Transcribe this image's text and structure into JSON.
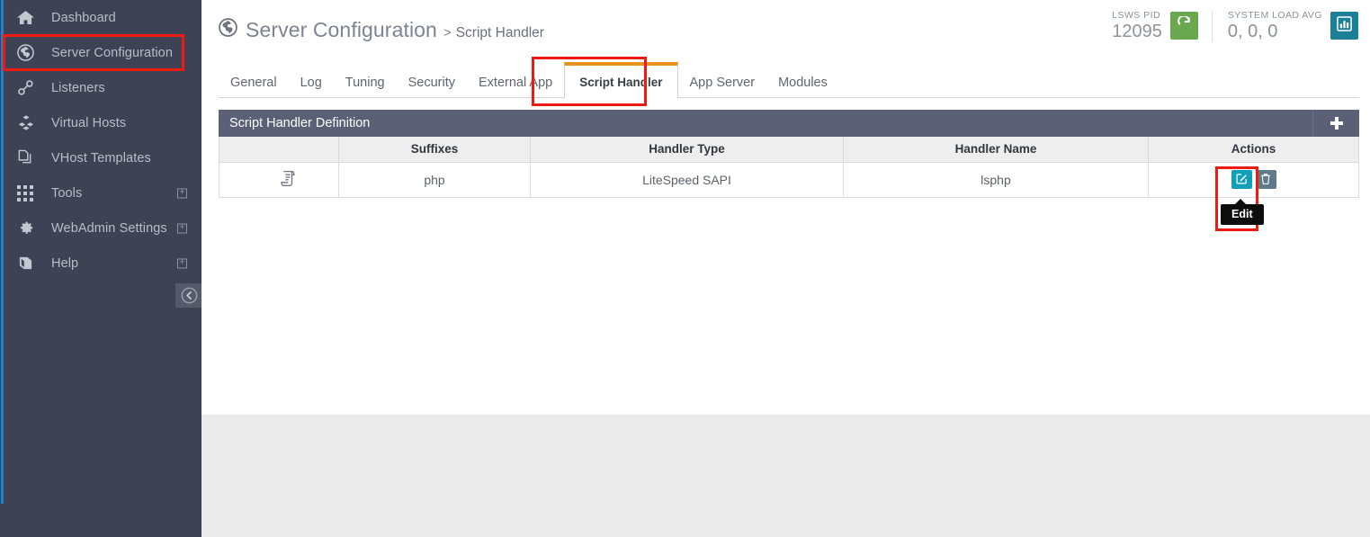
{
  "sidebar": {
    "items": [
      {
        "label": "Dashboard",
        "icon": "home-icon",
        "expandable": false,
        "highlighted": false
      },
      {
        "label": "Server Configuration",
        "icon": "globe-icon",
        "expandable": false,
        "highlighted": true
      },
      {
        "label": "Listeners",
        "icon": "link-icon",
        "expandable": false,
        "highlighted": false
      },
      {
        "label": "Virtual Hosts",
        "icon": "cubes-icon",
        "expandable": false,
        "highlighted": false
      },
      {
        "label": "VHost Templates",
        "icon": "copy-icon",
        "expandable": false,
        "highlighted": false
      },
      {
        "label": "Tools",
        "icon": "grid-icon",
        "expandable": true,
        "highlighted": false
      },
      {
        "label": "WebAdmin Settings",
        "icon": "gear-icon",
        "expandable": true,
        "highlighted": false
      },
      {
        "label": "Help",
        "icon": "book-icon",
        "expandable": true,
        "highlighted": false
      }
    ],
    "collapse_icon": "chevron-left-circle-icon",
    "background_color": "#3d4354"
  },
  "header": {
    "breadcrumb_icon": "globe-icon",
    "breadcrumb_main": "Server Configuration",
    "breadcrumb_separator": ">",
    "breadcrumb_sub": "Script Handler",
    "status": [
      {
        "label": "LSWS PID",
        "value": "12095",
        "button_icon": "reload-icon",
        "button_color": "#6aa84f"
      },
      {
        "label": "SYSTEM LOAD AVG",
        "value": "0, 0, 0",
        "button_icon": "bar-chart-icon",
        "button_color": "#1b7f96"
      }
    ]
  },
  "tabs": [
    {
      "label": "General",
      "active": false
    },
    {
      "label": "Log",
      "active": false
    },
    {
      "label": "Tuning",
      "active": false
    },
    {
      "label": "Security",
      "active": false
    },
    {
      "label": "External App",
      "active": false
    },
    {
      "label": "Script Handler",
      "active": true
    },
    {
      "label": "App Server",
      "active": false
    },
    {
      "label": "Modules",
      "active": false
    }
  ],
  "panel": {
    "title": "Script Handler Definition",
    "add_icon": "plus-icon",
    "columns": [
      "",
      "Suffixes",
      "Handler Type",
      "Handler Name",
      "Actions"
    ],
    "rows": [
      {
        "row_icon": "script-document-icon",
        "suffixes": "php",
        "handler_type": "LiteSpeed SAPI",
        "handler_name": "lsphp",
        "actions": [
          {
            "name": "edit-button",
            "icon": "pencil-square-icon",
            "color": "#12a0b8"
          },
          {
            "name": "delete-button",
            "icon": "trash-icon",
            "color": "#5f7b89"
          }
        ]
      }
    ]
  },
  "tooltip": {
    "text": "Edit"
  },
  "annotations": {
    "color": "#ee1b11",
    "targets": [
      "sidebar-item-server-configuration",
      "tab-script-handler",
      "row-actions"
    ]
  }
}
